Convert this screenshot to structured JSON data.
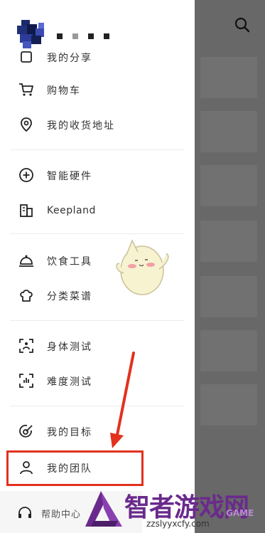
{
  "header": {
    "username_masked": "■ ■ ■ ■"
  },
  "menu": {
    "groups": [
      {
        "items": [
          {
            "label": "我的分享",
            "icon": "share-icon"
          },
          {
            "label": "购物车",
            "icon": "shopping-cart-icon"
          },
          {
            "label": "我的收货地址",
            "icon": "location-pin-icon"
          }
        ]
      },
      {
        "items": [
          {
            "label": "智能硬件",
            "icon": "plus-circle-icon"
          },
          {
            "label": "Keepland",
            "icon": "building-icon"
          }
        ]
      },
      {
        "items": [
          {
            "label": "饮食工具",
            "icon": "cloche-icon"
          },
          {
            "label": "分类菜谱",
            "icon": "chef-hat-icon"
          }
        ]
      },
      {
        "items": [
          {
            "label": "身体测试",
            "icon": "body-scan-icon"
          },
          {
            "label": "难度测试",
            "icon": "difficulty-scan-icon"
          }
        ]
      },
      {
        "items": [
          {
            "label": "我的目标",
            "icon": "target-icon"
          },
          {
            "label": "我的团队",
            "icon": "team-person-icon"
          }
        ]
      }
    ],
    "help_label": "帮助中心"
  },
  "watermark": {
    "title": "智者游戏网",
    "url": "zzslyyxcfy.com",
    "brand": "GAME"
  },
  "colors": {
    "highlight": "#e2311d",
    "watermark": "#6a2a8c"
  }
}
